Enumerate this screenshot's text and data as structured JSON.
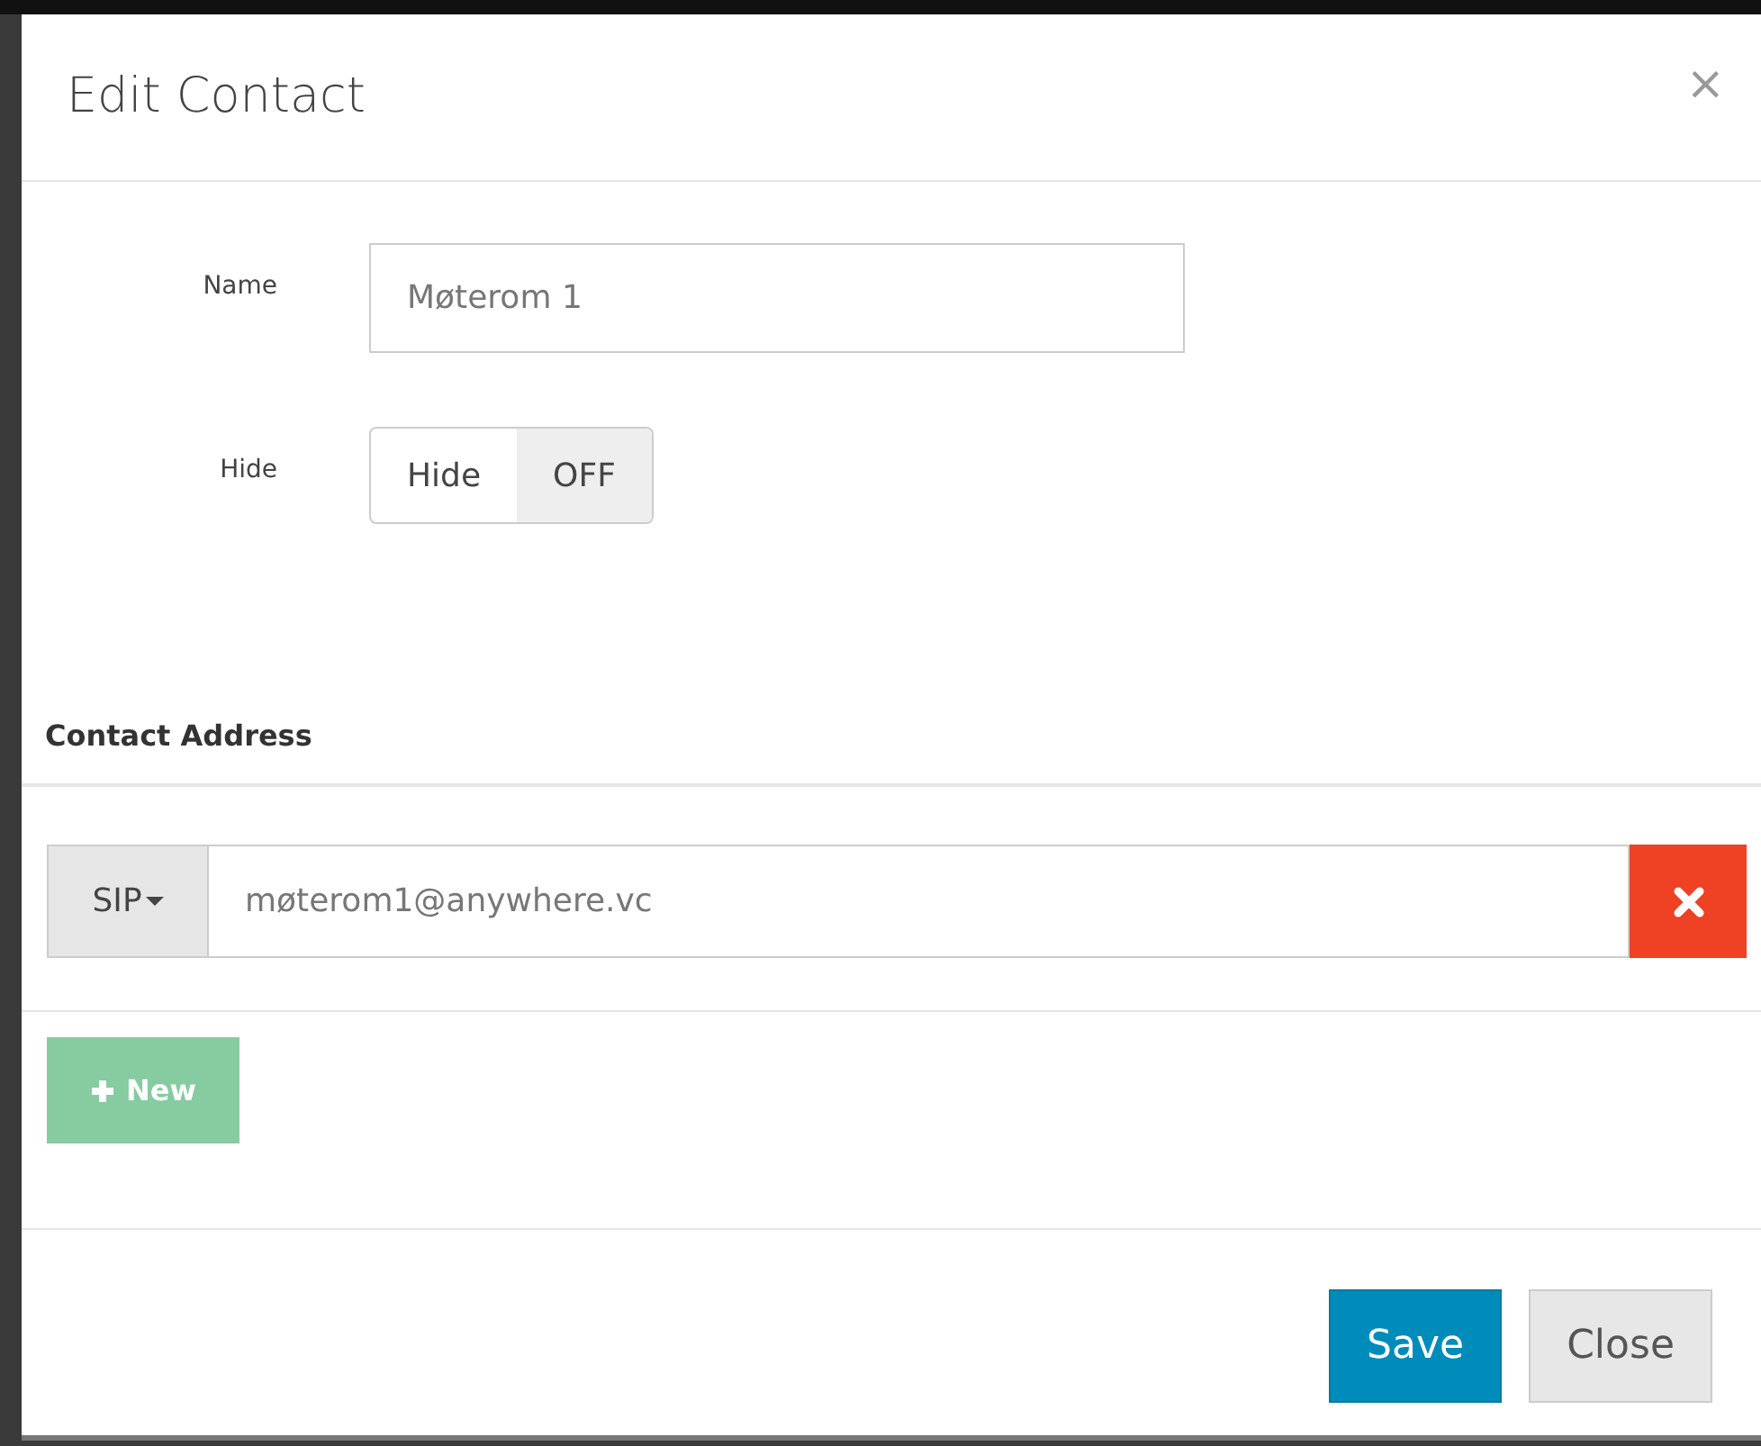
{
  "dialog": {
    "title": "Edit Contact",
    "close_icon": "×"
  },
  "fields": [
    {
      "kind": "text",
      "label": "Name",
      "value": "Møterom 1"
    },
    {
      "kind": "switch",
      "label": "Hide",
      "switch_label": "Hide",
      "state_text": "OFF",
      "on": false
    }
  ],
  "contact_address": {
    "heading": "Contact Address",
    "addresses": [
      {
        "protocol": "SIP",
        "value": "møterom1@anywhere.vc"
      }
    ],
    "new_button": {
      "label": "New",
      "disabled": true
    }
  },
  "footer": {
    "buttons": [
      {
        "label": "Save",
        "kind": "primary"
      },
      {
        "label": "Close",
        "kind": "default"
      }
    ]
  }
}
